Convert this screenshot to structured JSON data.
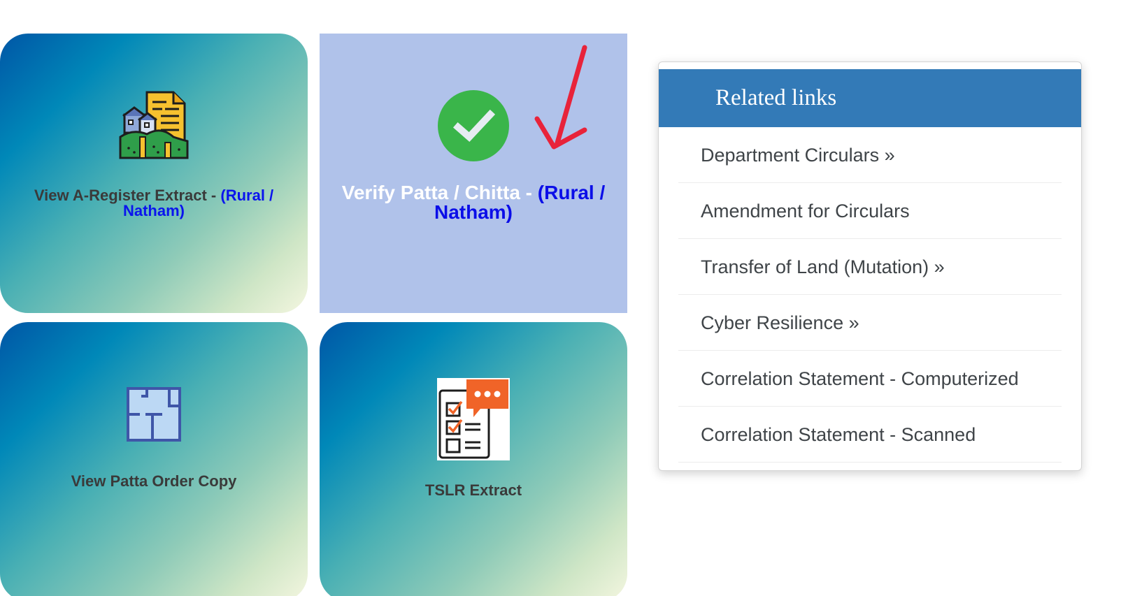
{
  "tiles": [
    {
      "label": "View A-Register Extract - ",
      "highlight": "(Rural / Natham)",
      "icon": "village-document-icon"
    },
    {
      "label": "Verify Patta / Chitta - ",
      "highlight": "(Rural / Natham)",
      "icon": "check-circle-icon"
    },
    {
      "label": "View Patta Order Copy",
      "icon": "floor-plan-icon"
    },
    {
      "label": "TSLR Extract",
      "icon": "checklist-chat-icon"
    }
  ],
  "related_links": {
    "title": "Related links",
    "items": [
      "Department Circulars »",
      "Amendment for Circulars",
      "Transfer of Land (Mutation) »",
      "Cyber Resilience »",
      "Correlation Statement - Computerized",
      "Correlation Statement - Scanned"
    ]
  },
  "colors": {
    "header_blue": "#337ab7",
    "highlight_blue": "#0a14ee",
    "active_tile": "#b0c2ea",
    "check_green": "#3ab54a",
    "arrow_red": "#e8233a"
  }
}
